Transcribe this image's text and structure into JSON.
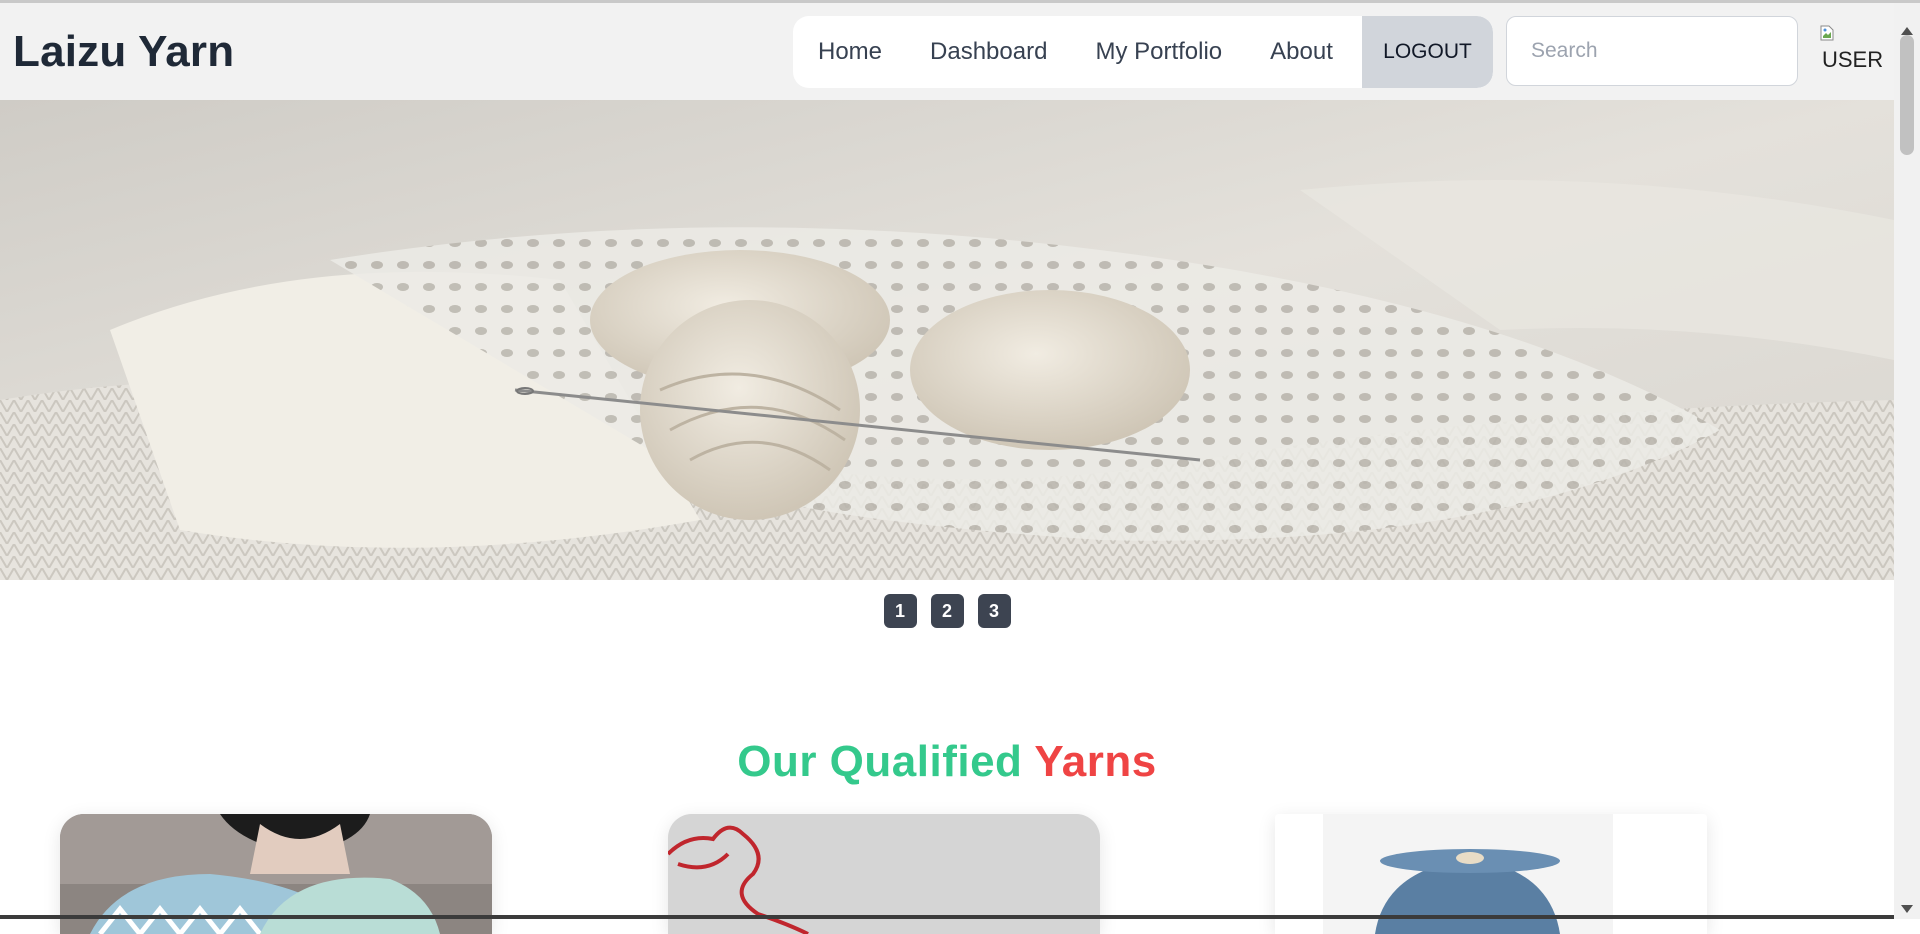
{
  "header": {
    "brand": "Laizu Yarn",
    "nav": {
      "items": [
        {
          "label": "Home"
        },
        {
          "label": "Dashboard"
        },
        {
          "label": "My Portfolio"
        },
        {
          "label": "About"
        }
      ],
      "logout": "LOGOUT"
    },
    "search": {
      "placeholder": "Search",
      "value": ""
    },
    "user": {
      "alt": "USER",
      "icon": "broken-image-icon"
    }
  },
  "hero": {
    "image": "knitted-yarn-photo",
    "carousel": {
      "pages": [
        "1",
        "2",
        "3"
      ]
    }
  },
  "section": {
    "title_part1": "Our Qualified",
    "title_part2": "Yarns"
  },
  "cards": [
    {
      "image": "woman-holding-knitted-scarves-photo"
    },
    {
      "image": "red-yarn-strand-photo"
    },
    {
      "image": "blue-yarn-cone-photo"
    }
  ],
  "colors": {
    "accent_green": "#34c98c",
    "accent_red": "#ef4444",
    "brand_text": "#1f2937",
    "logout_bg": "#d1d5db",
    "carousel_btn": "#3d4451"
  }
}
